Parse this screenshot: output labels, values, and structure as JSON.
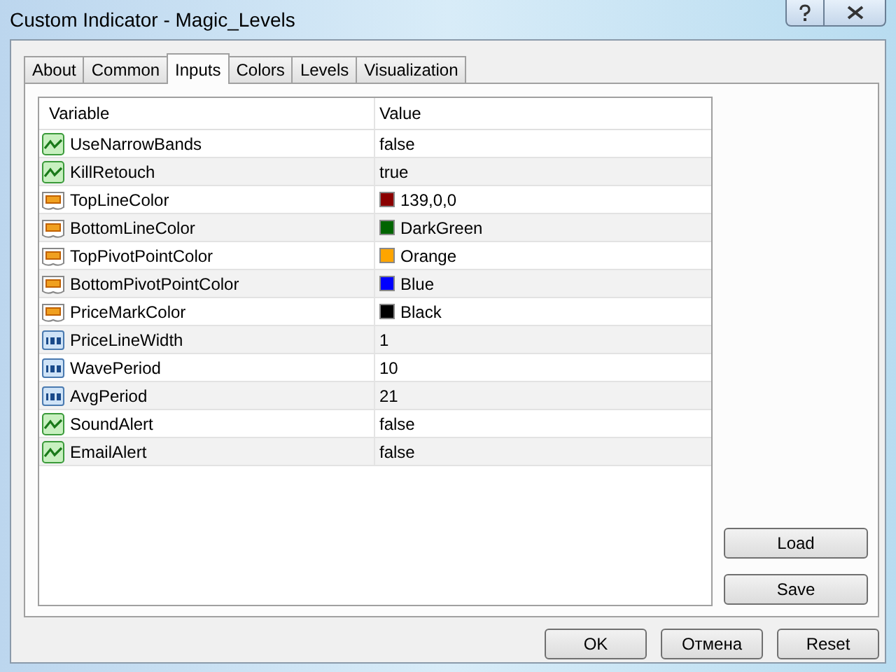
{
  "window": {
    "title": "Custom Indicator - Magic_Levels"
  },
  "tabs": [
    {
      "label": "About",
      "selected": false
    },
    {
      "label": "Common",
      "selected": false
    },
    {
      "label": "Inputs",
      "selected": true
    },
    {
      "label": "Colors",
      "selected": false
    },
    {
      "label": "Levels",
      "selected": false
    },
    {
      "label": "Visualization",
      "selected": false
    }
  ],
  "table": {
    "columns": [
      "Variable",
      "Value"
    ],
    "rows": [
      {
        "kind": "bool",
        "variable": "UseNarrowBands",
        "value": "false"
      },
      {
        "kind": "bool",
        "variable": "KillRetouch",
        "value": "true"
      },
      {
        "kind": "color",
        "variable": "TopLineColor",
        "value": "139,0,0",
        "color": "#8b0000"
      },
      {
        "kind": "color",
        "variable": "BottomLineColor",
        "value": "DarkGreen",
        "color": "#006400"
      },
      {
        "kind": "color",
        "variable": "TopPivotPointColor",
        "value": "Orange",
        "color": "#ffa500"
      },
      {
        "kind": "color",
        "variable": "BottomPivotPointColor",
        "value": "Blue",
        "color": "#0000ff"
      },
      {
        "kind": "color",
        "variable": "PriceMarkColor",
        "value": "Black",
        "color": "#000000"
      },
      {
        "kind": "int",
        "variable": "PriceLineWidth",
        "value": "1"
      },
      {
        "kind": "int",
        "variable": "WavePeriod",
        "value": "10"
      },
      {
        "kind": "int",
        "variable": "AvgPeriod",
        "value": "21"
      },
      {
        "kind": "bool",
        "variable": "SoundAlert",
        "value": "false"
      },
      {
        "kind": "bool",
        "variable": "EmailAlert",
        "value": "false"
      }
    ]
  },
  "side_buttons": [
    "Load",
    "Save"
  ],
  "buttons": [
    "OK",
    "Отмена",
    "Reset"
  ]
}
